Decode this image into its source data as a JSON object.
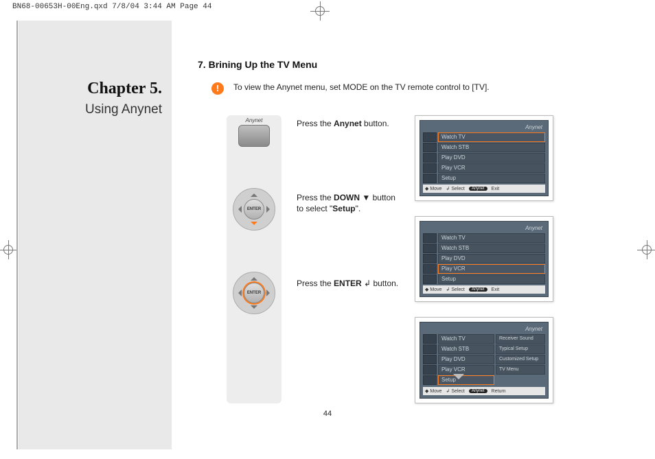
{
  "print_header": "BN68-00653H-00Eng.qxd  7/8/04 3:44 AM  Page 44",
  "chapter": {
    "title": "Chapter 5.",
    "subtitle": "Using Anynet"
  },
  "section": {
    "number": "7.",
    "title": "Brining Up the TV Menu"
  },
  "notice": {
    "icon": "!",
    "text": "To view the Anynet menu, set MODE on the TV remote control to [TV]."
  },
  "steps": [
    {
      "text_pre": "Press the ",
      "bold": "Anynet",
      "text_post": " button."
    },
    {
      "text_pre": "Press the ",
      "bold": "DOWN",
      "icon": "▼",
      "text_mid": " button to select \"",
      "bold2": "Setup",
      "text_post": "\"."
    },
    {
      "text_pre": "Press the ",
      "bold": "ENTER",
      "icon": "↲",
      "text_post": " button."
    }
  ],
  "remote": {
    "anynet_label": "Anynet",
    "enter_label": "ENTER"
  },
  "menus": {
    "brand": "Anynet",
    "items": [
      "Watch TV",
      "Watch STB",
      "Play DVD",
      "Play VCR",
      "Setup"
    ],
    "submenu": [
      "Receiver Sound",
      "Typical Setup",
      "Customized Setup",
      "TV Menu"
    ],
    "footer": {
      "move": "Move",
      "select": "Select",
      "anynet": "Anynet",
      "exit": "Exit",
      "return": "Return"
    }
  },
  "page_number": "44"
}
